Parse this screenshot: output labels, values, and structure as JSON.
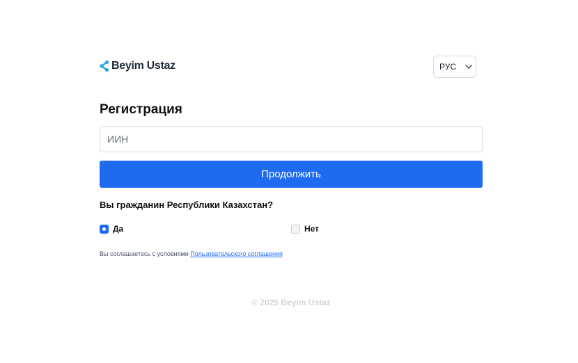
{
  "header": {
    "logo_text": "Beyim Ustaz",
    "language": {
      "selected": "РУС"
    }
  },
  "form": {
    "title": "Регистрация",
    "iin_placeholder": "ИИН",
    "iin_value": "",
    "continue_label": "Продолжить",
    "citizenship_question": "Вы гражданин Республики Казахстан?",
    "options": [
      {
        "label": "Да",
        "selected": true
      },
      {
        "label": "Нет",
        "selected": false
      }
    ],
    "terms_prefix": "Вы соглашаетесь с условиями",
    "terms_link": "Пользовательского соглашения"
  },
  "footer": {
    "copyright": "© 2025 Beyim Ustaz"
  },
  "colors": {
    "accent": "#1f6bf0",
    "logo_mark": "#2fa6e0",
    "footer_text": "#d1d5db"
  },
  "icons": {
    "logo": "beyim-logo-icon",
    "language_chevron": "chevron-down-icon"
  }
}
